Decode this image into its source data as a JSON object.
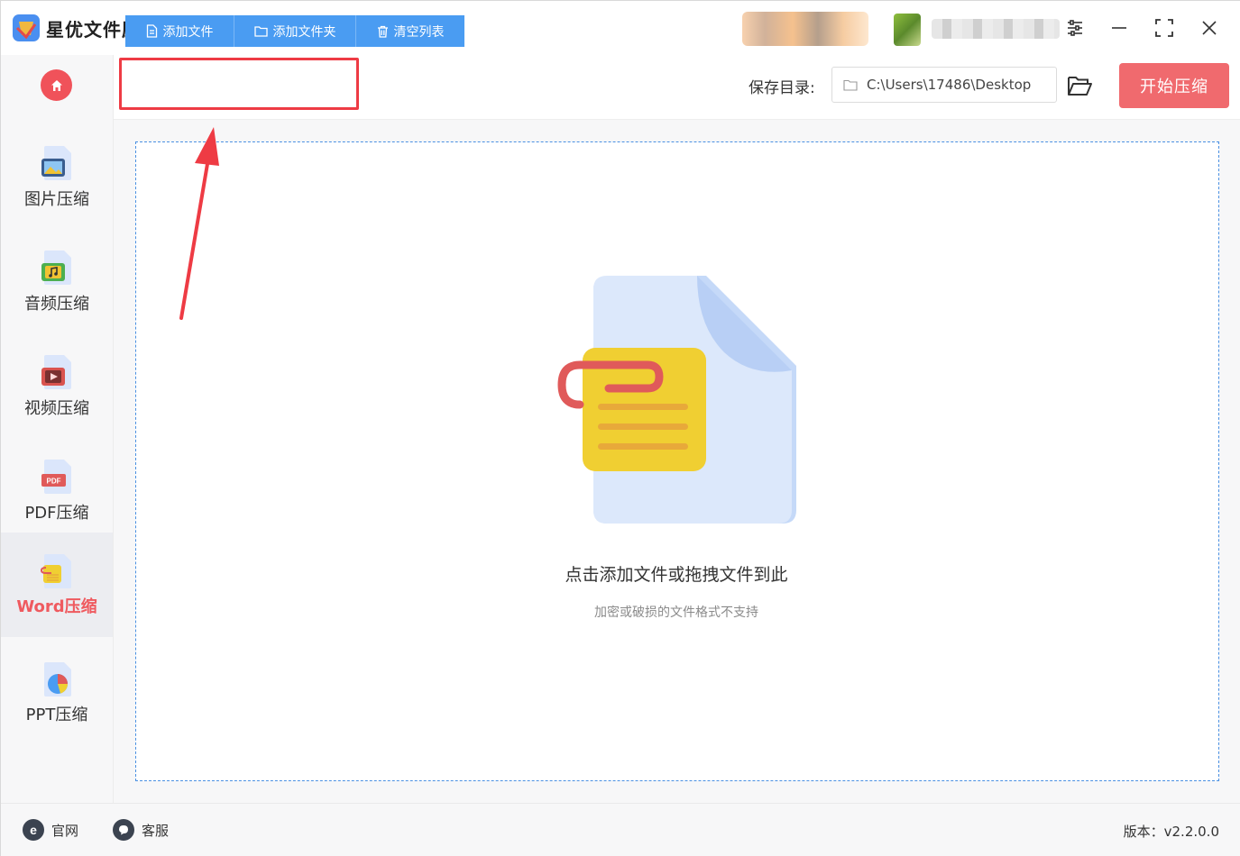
{
  "app": {
    "title": "星优文件压缩器"
  },
  "sidebar": {
    "items": [
      {
        "label": "图片压缩",
        "icon": "image-file-icon"
      },
      {
        "label": "音频压缩",
        "icon": "audio-file-icon"
      },
      {
        "label": "视频压缩",
        "icon": "video-file-icon"
      },
      {
        "label": "PDF压缩",
        "icon": "pdf-file-icon"
      },
      {
        "label": "Word压缩",
        "icon": "word-file-icon",
        "active": true
      },
      {
        "label": "PPT压缩",
        "icon": "ppt-file-icon"
      }
    ]
  },
  "toolbar": {
    "add_file": "添加文件",
    "add_folder": "添加文件夹",
    "clear_list": "清空列表",
    "save_dir_label": "保存目录:",
    "save_dir_value": "C:\\Users\\17486\\Desktop",
    "start": "开始压缩"
  },
  "dropzone": {
    "title": "点击添加文件或拖拽文件到此",
    "subtitle": "加密或破损的文件格式不支持"
  },
  "footer": {
    "website": "官网",
    "support": "客服",
    "version": "版本：v2.2.0.0"
  },
  "colors": {
    "accent_blue": "#4a9cf2",
    "accent_red": "#f06a6e",
    "highlight": "#ee3b44"
  }
}
